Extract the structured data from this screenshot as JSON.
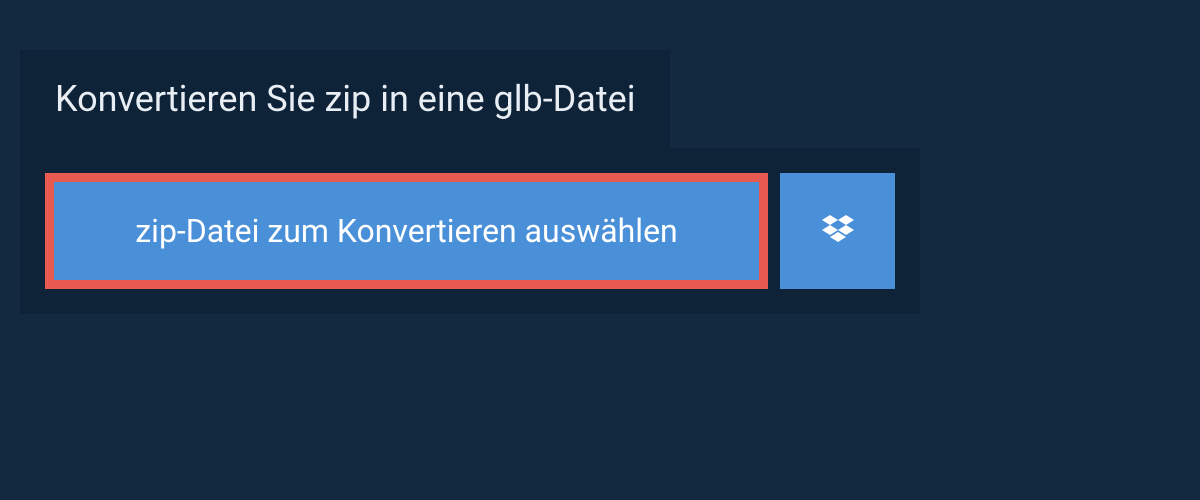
{
  "header": {
    "title": "Konvertieren Sie zip in eine glb-Datei"
  },
  "upload": {
    "select_file_label": "zip-Datei zum Konvertieren auswählen"
  },
  "colors": {
    "background": "#12293f",
    "panel": "#0e2338",
    "button": "#4a90d9",
    "highlight_border": "#e85a4f"
  }
}
